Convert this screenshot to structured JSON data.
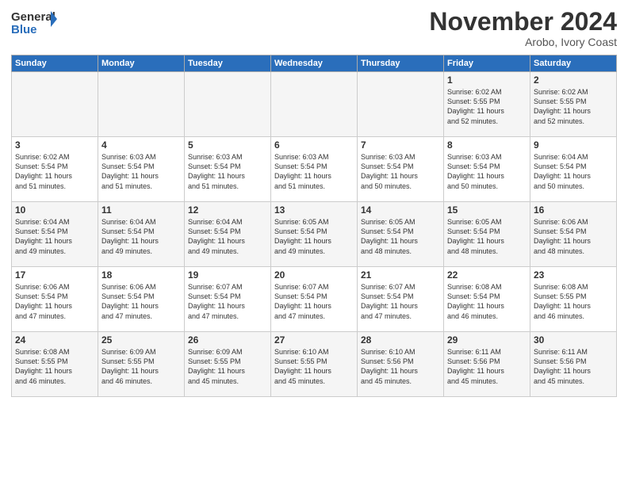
{
  "header": {
    "logo_general": "General",
    "logo_blue": "Blue",
    "month_title": "November 2024",
    "location": "Arobo, Ivory Coast"
  },
  "days_of_week": [
    "Sunday",
    "Monday",
    "Tuesday",
    "Wednesday",
    "Thursday",
    "Friday",
    "Saturday"
  ],
  "weeks": [
    [
      {
        "day": "",
        "info": ""
      },
      {
        "day": "",
        "info": ""
      },
      {
        "day": "",
        "info": ""
      },
      {
        "day": "",
        "info": ""
      },
      {
        "day": "",
        "info": ""
      },
      {
        "day": "1",
        "info": "Sunrise: 6:02 AM\nSunset: 5:55 PM\nDaylight: 11 hours\nand 52 minutes."
      },
      {
        "day": "2",
        "info": "Sunrise: 6:02 AM\nSunset: 5:55 PM\nDaylight: 11 hours\nand 52 minutes."
      }
    ],
    [
      {
        "day": "3",
        "info": "Sunrise: 6:02 AM\nSunset: 5:54 PM\nDaylight: 11 hours\nand 51 minutes."
      },
      {
        "day": "4",
        "info": "Sunrise: 6:03 AM\nSunset: 5:54 PM\nDaylight: 11 hours\nand 51 minutes."
      },
      {
        "day": "5",
        "info": "Sunrise: 6:03 AM\nSunset: 5:54 PM\nDaylight: 11 hours\nand 51 minutes."
      },
      {
        "day": "6",
        "info": "Sunrise: 6:03 AM\nSunset: 5:54 PM\nDaylight: 11 hours\nand 51 minutes."
      },
      {
        "day": "7",
        "info": "Sunrise: 6:03 AM\nSunset: 5:54 PM\nDaylight: 11 hours\nand 50 minutes."
      },
      {
        "day": "8",
        "info": "Sunrise: 6:03 AM\nSunset: 5:54 PM\nDaylight: 11 hours\nand 50 minutes."
      },
      {
        "day": "9",
        "info": "Sunrise: 6:04 AM\nSunset: 5:54 PM\nDaylight: 11 hours\nand 50 minutes."
      }
    ],
    [
      {
        "day": "10",
        "info": "Sunrise: 6:04 AM\nSunset: 5:54 PM\nDaylight: 11 hours\nand 49 minutes."
      },
      {
        "day": "11",
        "info": "Sunrise: 6:04 AM\nSunset: 5:54 PM\nDaylight: 11 hours\nand 49 minutes."
      },
      {
        "day": "12",
        "info": "Sunrise: 6:04 AM\nSunset: 5:54 PM\nDaylight: 11 hours\nand 49 minutes."
      },
      {
        "day": "13",
        "info": "Sunrise: 6:05 AM\nSunset: 5:54 PM\nDaylight: 11 hours\nand 49 minutes."
      },
      {
        "day": "14",
        "info": "Sunrise: 6:05 AM\nSunset: 5:54 PM\nDaylight: 11 hours\nand 48 minutes."
      },
      {
        "day": "15",
        "info": "Sunrise: 6:05 AM\nSunset: 5:54 PM\nDaylight: 11 hours\nand 48 minutes."
      },
      {
        "day": "16",
        "info": "Sunrise: 6:06 AM\nSunset: 5:54 PM\nDaylight: 11 hours\nand 48 minutes."
      }
    ],
    [
      {
        "day": "17",
        "info": "Sunrise: 6:06 AM\nSunset: 5:54 PM\nDaylight: 11 hours\nand 47 minutes."
      },
      {
        "day": "18",
        "info": "Sunrise: 6:06 AM\nSunset: 5:54 PM\nDaylight: 11 hours\nand 47 minutes."
      },
      {
        "day": "19",
        "info": "Sunrise: 6:07 AM\nSunset: 5:54 PM\nDaylight: 11 hours\nand 47 minutes."
      },
      {
        "day": "20",
        "info": "Sunrise: 6:07 AM\nSunset: 5:54 PM\nDaylight: 11 hours\nand 47 minutes."
      },
      {
        "day": "21",
        "info": "Sunrise: 6:07 AM\nSunset: 5:54 PM\nDaylight: 11 hours\nand 47 minutes."
      },
      {
        "day": "22",
        "info": "Sunrise: 6:08 AM\nSunset: 5:54 PM\nDaylight: 11 hours\nand 46 minutes."
      },
      {
        "day": "23",
        "info": "Sunrise: 6:08 AM\nSunset: 5:55 PM\nDaylight: 11 hours\nand 46 minutes."
      }
    ],
    [
      {
        "day": "24",
        "info": "Sunrise: 6:08 AM\nSunset: 5:55 PM\nDaylight: 11 hours\nand 46 minutes."
      },
      {
        "day": "25",
        "info": "Sunrise: 6:09 AM\nSunset: 5:55 PM\nDaylight: 11 hours\nand 46 minutes."
      },
      {
        "day": "26",
        "info": "Sunrise: 6:09 AM\nSunset: 5:55 PM\nDaylight: 11 hours\nand 45 minutes."
      },
      {
        "day": "27",
        "info": "Sunrise: 6:10 AM\nSunset: 5:55 PM\nDaylight: 11 hours\nand 45 minutes."
      },
      {
        "day": "28",
        "info": "Sunrise: 6:10 AM\nSunset: 5:56 PM\nDaylight: 11 hours\nand 45 minutes."
      },
      {
        "day": "29",
        "info": "Sunrise: 6:11 AM\nSunset: 5:56 PM\nDaylight: 11 hours\nand 45 minutes."
      },
      {
        "day": "30",
        "info": "Sunrise: 6:11 AM\nSunset: 5:56 PM\nDaylight: 11 hours\nand 45 minutes."
      }
    ]
  ]
}
